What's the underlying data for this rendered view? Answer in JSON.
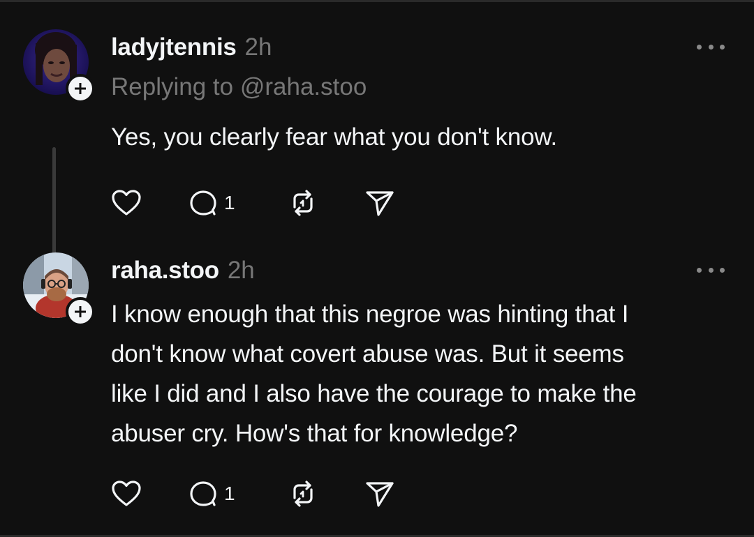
{
  "posts": [
    {
      "username": "ladyjtennis",
      "time": "2h",
      "replying_to": "Replying to @raha.stoo",
      "text": "Yes, you clearly fear what you don't know.",
      "like_count": "",
      "reply_count": "1",
      "avatar_icon": "avatar-photo-woman",
      "has_thread_line": true
    },
    {
      "username": "raha.stoo",
      "time": "2h",
      "text_lines": [
        "I know enough that this negroe was hinting that I",
        "don't know what covert abuse was. But it seems",
        "like I did and I also have the courage to make the",
        "abuser cry. How's that for knowledge?"
      ],
      "reply_count": "1",
      "avatar_icon": "avatar-photo-man"
    }
  ],
  "icons": {
    "like": "heart-icon",
    "reply": "comment-icon",
    "repost": "repost-icon",
    "share": "send-icon",
    "more": "more-horizontal-icon",
    "follow": "plus-icon"
  },
  "colors": {
    "background": "#101010",
    "text_primary": "#f3f5f7",
    "text_secondary": "#777777",
    "thread_line": "#3a3a3a"
  }
}
